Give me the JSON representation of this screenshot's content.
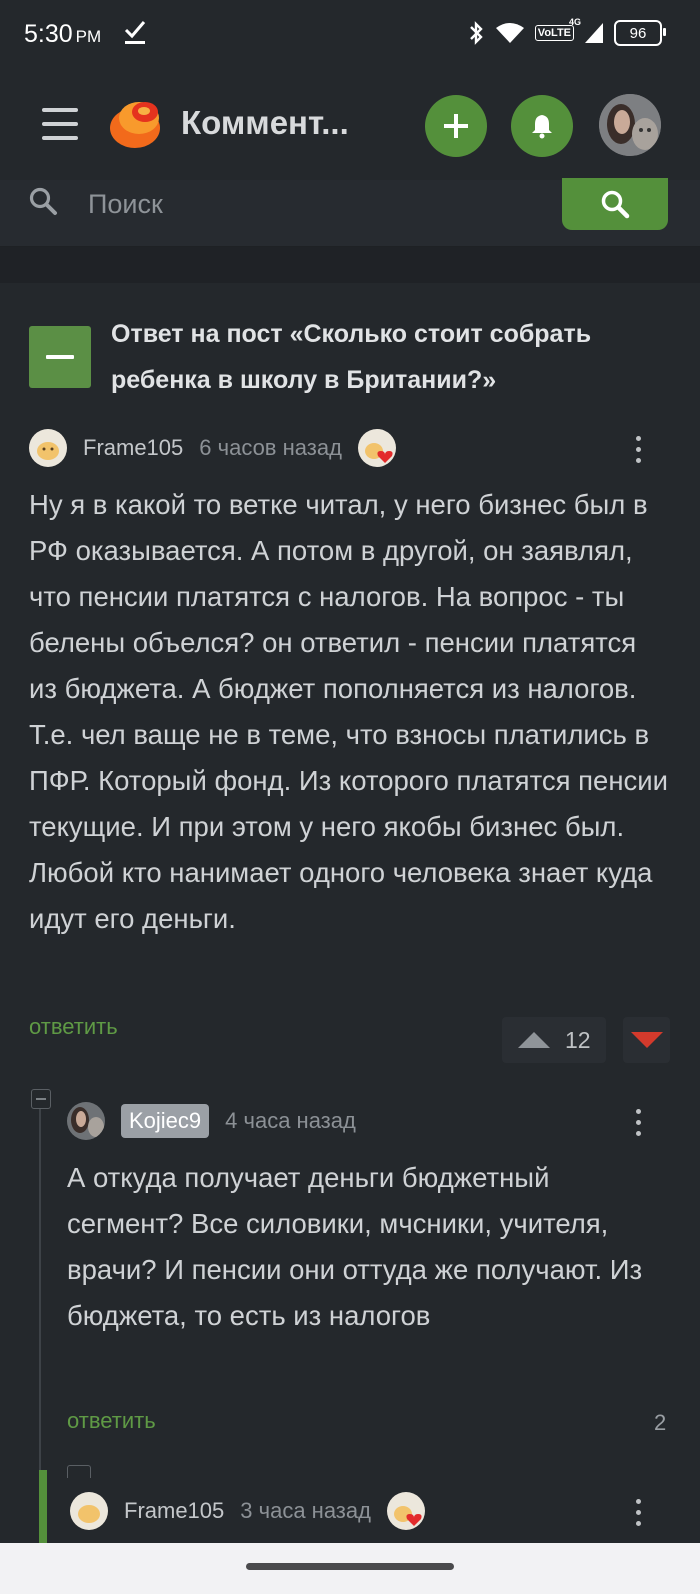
{
  "status_bar": {
    "time": "5:30",
    "ampm": "PM",
    "volte": "VoLTE",
    "network": "4G",
    "battery": "96"
  },
  "app_bar": {
    "title": "Коммент...",
    "accent": "#54903b"
  },
  "search": {
    "placeholder": "Поиск"
  },
  "post": {
    "title": "Ответ на пост «Сколько стоит собрать ребенка в школу в Британии?»"
  },
  "comments": [
    {
      "author": "Frame105",
      "time": "6 часов назад",
      "body": "Ну я в какой то ветке читал, у него бизнес был в РФ оказывается. А потом в другой, он заявлял, что пенсии платятся с налогов. На вопрос - ты белены объелся? он ответил - пенсии платятся из бюджета. А бюджет пополняется из налогов. Т.е. чел ваще не в теме, что взносы платились в ПФР. Который фонд. Из которого платятся пенсии текущие. И при этом у него якобы бизнес был. Любой кто нанимает одного человека знает куда идут его деньги.",
      "reply_label": "ответить",
      "rating": "12"
    },
    {
      "author": "Kojiec9",
      "time": "4 часа назад",
      "body": "А откуда получает деньги бюджетный сегмент? Все силовики, мчсники, учителя, врачи? И пенсии они оттуда же получают. Из бюджета, то есть из налогов",
      "reply_label": "ответить",
      "replies_count": "2"
    },
    {
      "author": "Frame105",
      "time": "3 часа назад"
    }
  ],
  "icons": {
    "menu": "hamburger-icon",
    "logo": "pikabu-logo",
    "add": "plus-icon",
    "notifications": "bell-icon",
    "search": "search-icon",
    "vote_up": "triangle-up-icon",
    "vote_down": "triangle-down-icon",
    "more": "kebab-icon",
    "award": "award-heart-icon"
  }
}
